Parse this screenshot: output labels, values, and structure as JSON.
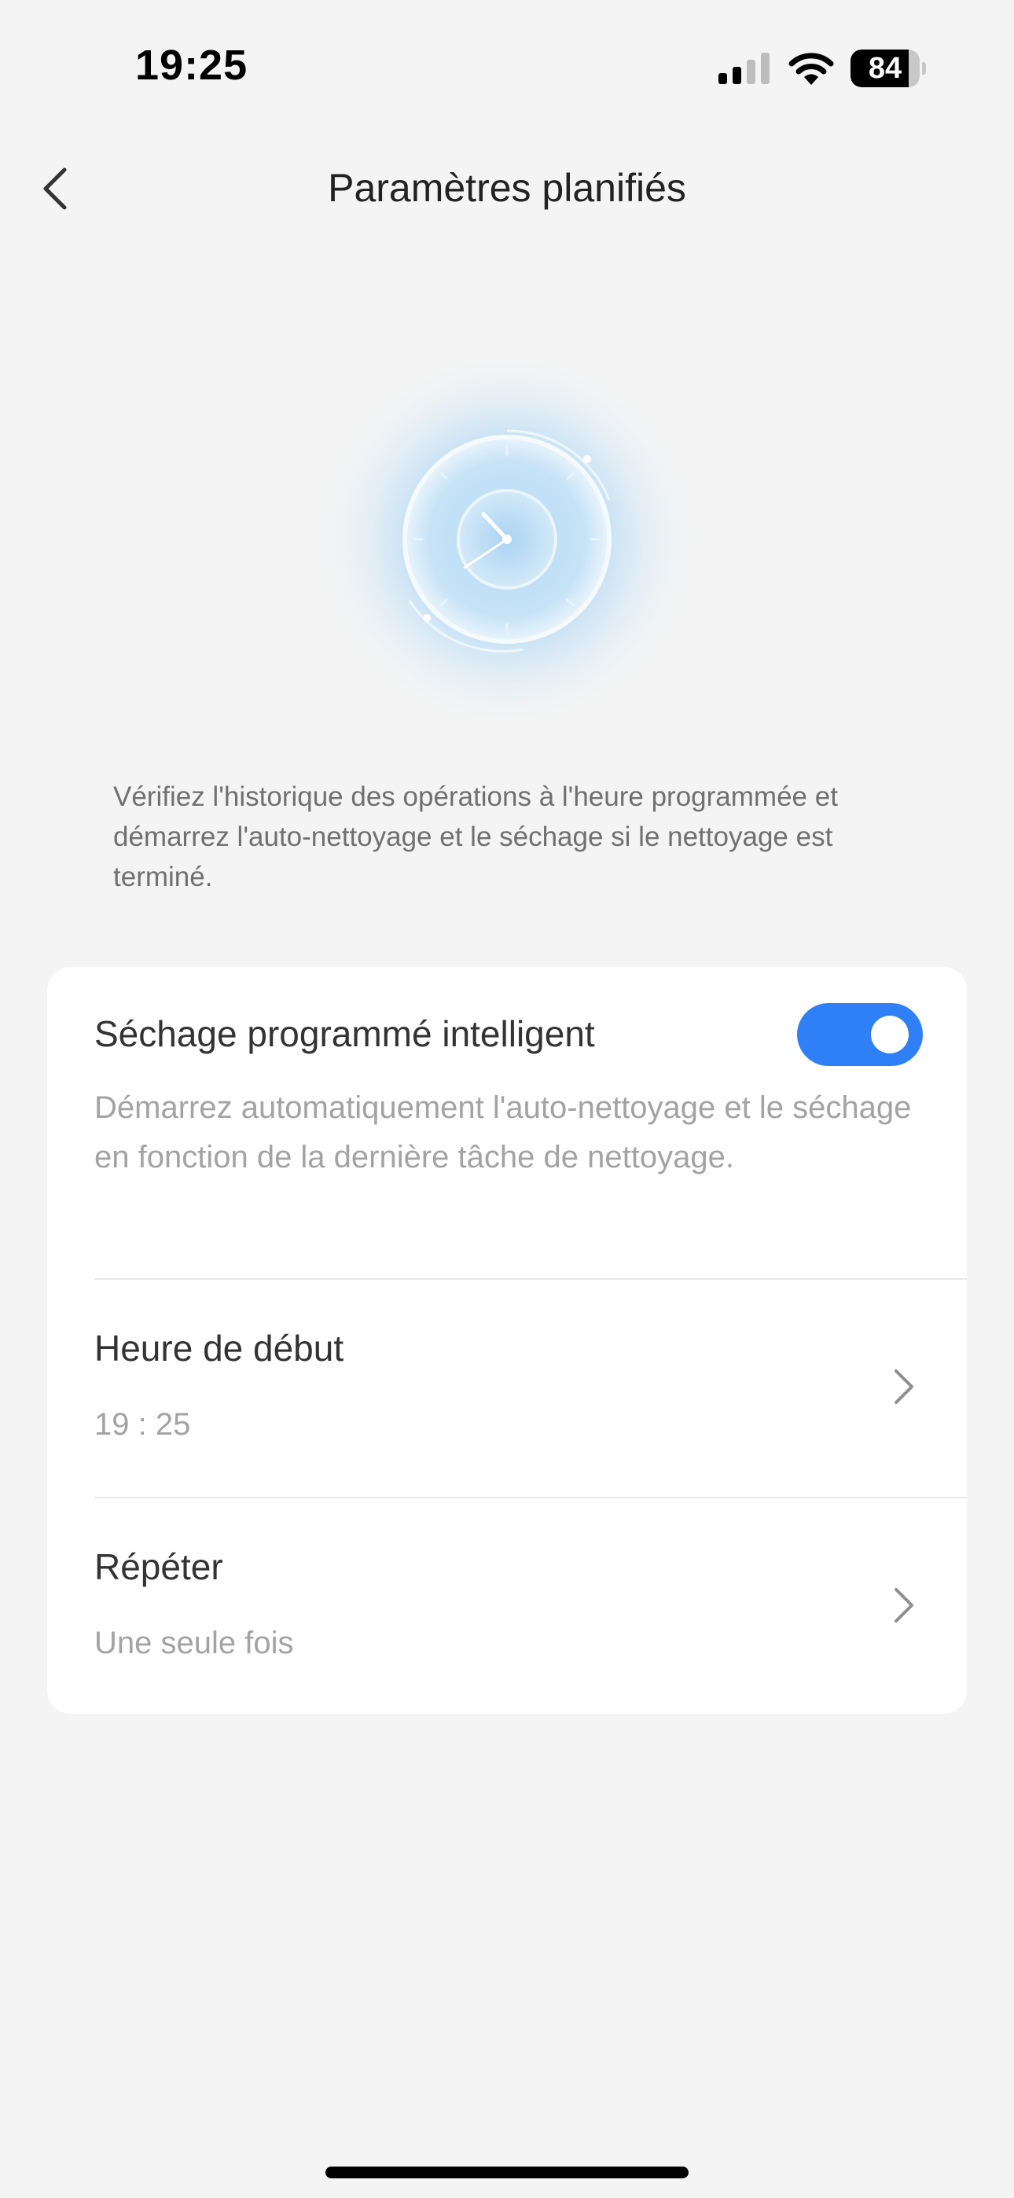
{
  "status_bar": {
    "time": "19:25",
    "battery_level": "84",
    "battery_fraction": 0.84,
    "signal_icon": "cellular-signal-icon",
    "wifi_icon": "wifi-icon"
  },
  "header": {
    "title": "Paramètres planifiés",
    "back_icon": "chevron-left-icon"
  },
  "hero": {
    "icon": "clock-icon"
  },
  "description": "Vérifiez l'historique des opérations à l'heure programmée et démarrez l'auto-nettoyage et le séchage si le nettoyage est terminé.",
  "card": {
    "smart_drying": {
      "title": "Séchage programmé intelligent",
      "description": "Démarrez automatiquement l'auto-nettoyage et le séchage en fonction de la dernière tâche de nettoyage.",
      "enabled": true
    },
    "start_time": {
      "title": "Heure de début",
      "value": "19 : 25"
    },
    "repeat": {
      "title": "Répéter",
      "value": "Une seule fois"
    }
  },
  "colors": {
    "accent": "#2f80f6",
    "background": "#f4f4f4",
    "card": "#ffffff",
    "secondary_text": "#a3a3a3"
  }
}
